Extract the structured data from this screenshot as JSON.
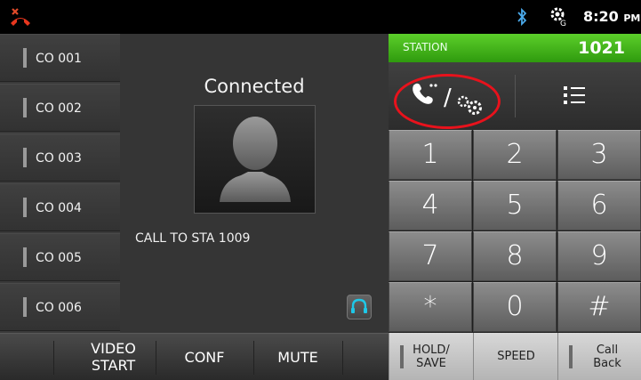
{
  "status_bar": {
    "time": "8:20",
    "ampm": "PM",
    "icons": [
      "missed-call-icon",
      "bluetooth-icon",
      "settings-network-icon"
    ]
  },
  "co_lines": [
    {
      "label": "CO 001"
    },
    {
      "label": "CO 002"
    },
    {
      "label": "CO 003"
    },
    {
      "label": "CO 004"
    },
    {
      "label": "CO 005"
    },
    {
      "label": "CO 006"
    }
  ],
  "call": {
    "status": "Connected",
    "target": "CALL TO STA 1009"
  },
  "station": {
    "label": "STATION",
    "number": "1021"
  },
  "keypad": [
    "1",
    "2",
    "3",
    "4",
    "5",
    "6",
    "7",
    "8",
    "9",
    "*",
    "0",
    "#"
  ],
  "bottom_actions": [
    {
      "line1": "VIDEO",
      "line2": "START"
    },
    {
      "line1": "CONF",
      "line2": ""
    },
    {
      "line1": "MUTE",
      "line2": ""
    }
  ],
  "right_actions": [
    {
      "line1": "HOLD/",
      "line2": "SAVE"
    },
    {
      "line1": "SPEED",
      "line2": ""
    },
    {
      "line1": "Call",
      "line2": "Back"
    }
  ],
  "colors": {
    "station_green": "#3fae17",
    "highlight_red": "#e8121c",
    "headset_cyan": "#1ec8e8"
  }
}
